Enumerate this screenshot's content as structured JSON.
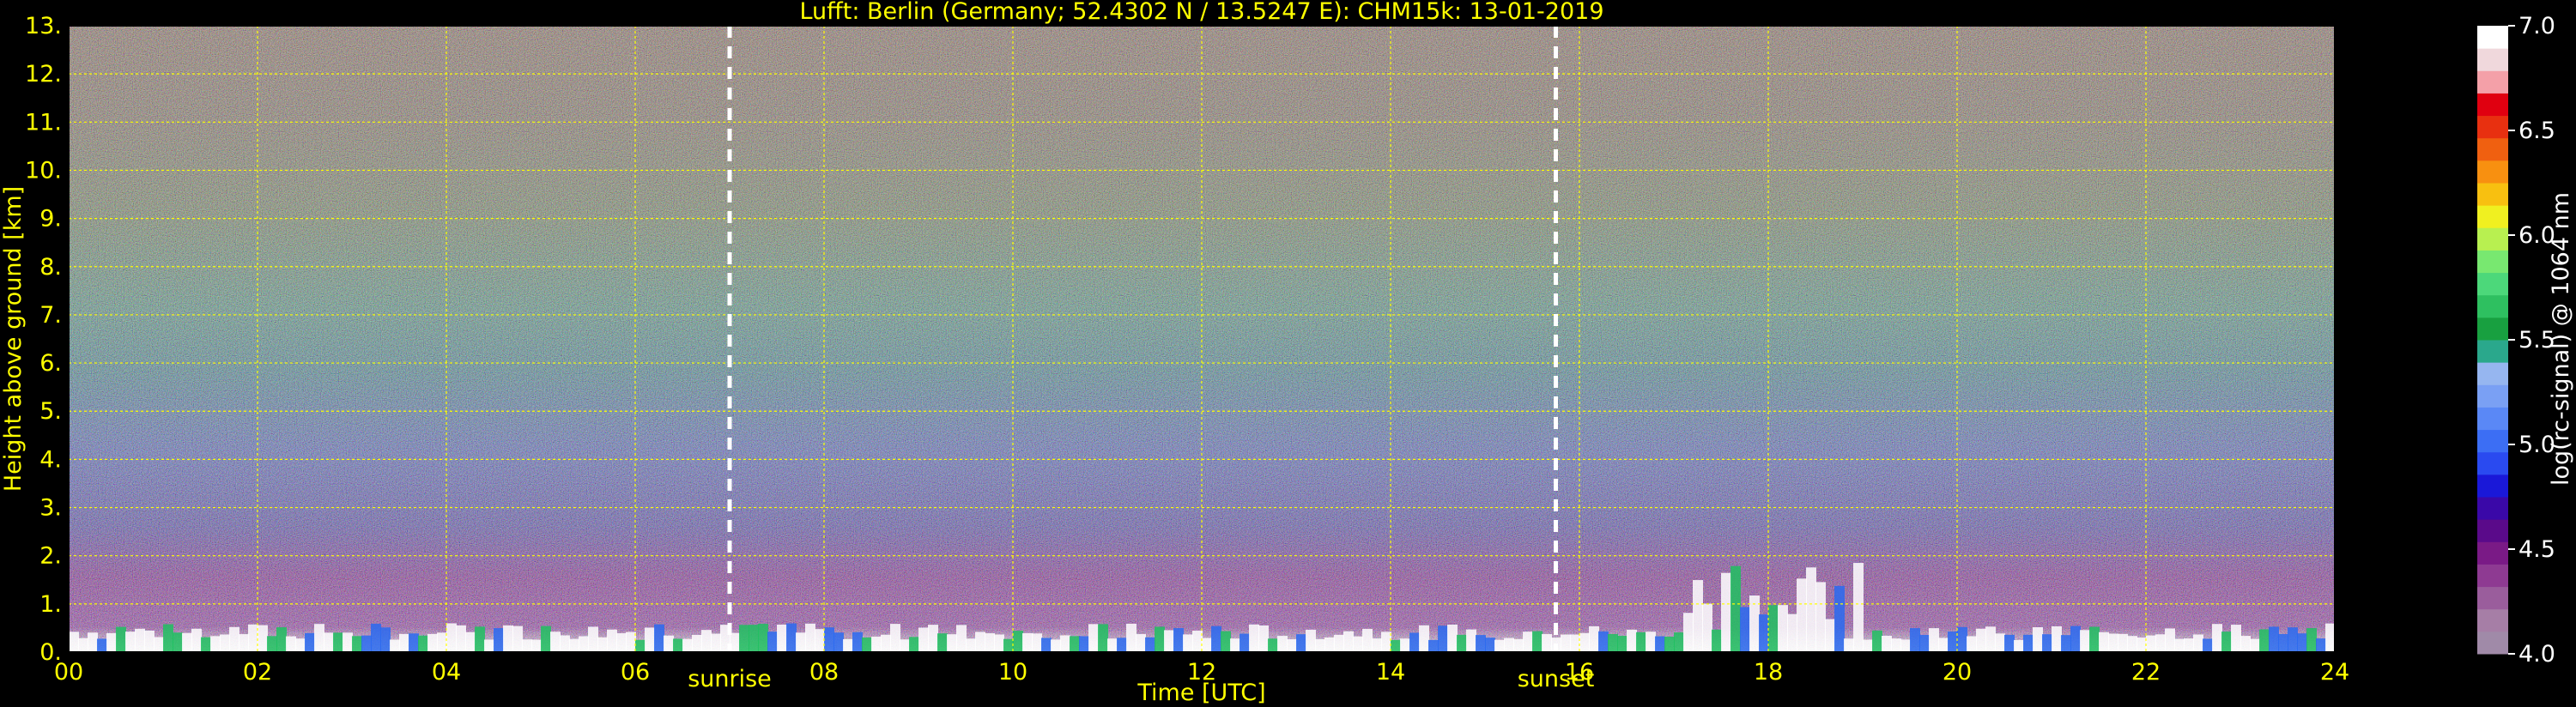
{
  "chart_data": {
    "type": "heatmap",
    "title": "Lufft: Berlin (Germany; 52.4302 N / 13.5247 E):    CHM15k: 13-01-2019",
    "xlabel": "Time [UTC]",
    "ylabel": "Height above ground [km]",
    "xlim": [
      0,
      24
    ],
    "ylim": [
      0,
      13
    ],
    "x_ticks": [
      0,
      2,
      4,
      6,
      8,
      10,
      12,
      14,
      16,
      18,
      20,
      22,
      24
    ],
    "x_tick_labels": [
      "00",
      "02",
      "04",
      "06",
      "08",
      "10",
      "12",
      "14",
      "16",
      "18",
      "20",
      "22",
      "24"
    ],
    "y_ticks": [
      0,
      1,
      2,
      3,
      4,
      5,
      6,
      7,
      8,
      9,
      10,
      11,
      12,
      13
    ],
    "y_tick_labels": [
      "0.",
      "1.",
      "2.",
      "3.",
      "4.",
      "5.",
      "6.",
      "7.",
      "8.",
      "9.",
      "10.",
      "11.",
      "12.",
      "13."
    ],
    "grid": true,
    "grid_color": "#ffff00",
    "text_color": "#ffff00",
    "markers": [
      {
        "label": "sunrise",
        "x": 7.0
      },
      {
        "label": "sunset",
        "x": 15.75
      }
    ],
    "colorbar": {
      "label": "log(rc-signal) @ 1064 nm",
      "range": [
        4.0,
        7.0
      ],
      "ticks": [
        4.0,
        4.5,
        5.0,
        5.5,
        6.0,
        6.5,
        7.0
      ],
      "tick_labels": [
        "4.0",
        "4.5",
        "5.0",
        "5.5",
        "6.0",
        "6.5",
        "7.0"
      ],
      "colors": [
        "#a08aa8",
        "#a67ea6",
        "#9a5d9c",
        "#8e3a92",
        "#7a1a86",
        "#5a0a8a",
        "#3a08a8",
        "#1a18d8",
        "#2a4af0",
        "#3c6ef4",
        "#5a88f6",
        "#7aa0f4",
        "#96b6f0",
        "#2aa88c",
        "#18a040",
        "#2ec060",
        "#4cd87a",
        "#78e870",
        "#b8f050",
        "#f0f020",
        "#f8c010",
        "#f89010",
        "#f06010",
        "#e83010",
        "#e00010",
        "#f4a0a8",
        "#f0d8dc",
        "#ffffff"
      ]
    }
  }
}
